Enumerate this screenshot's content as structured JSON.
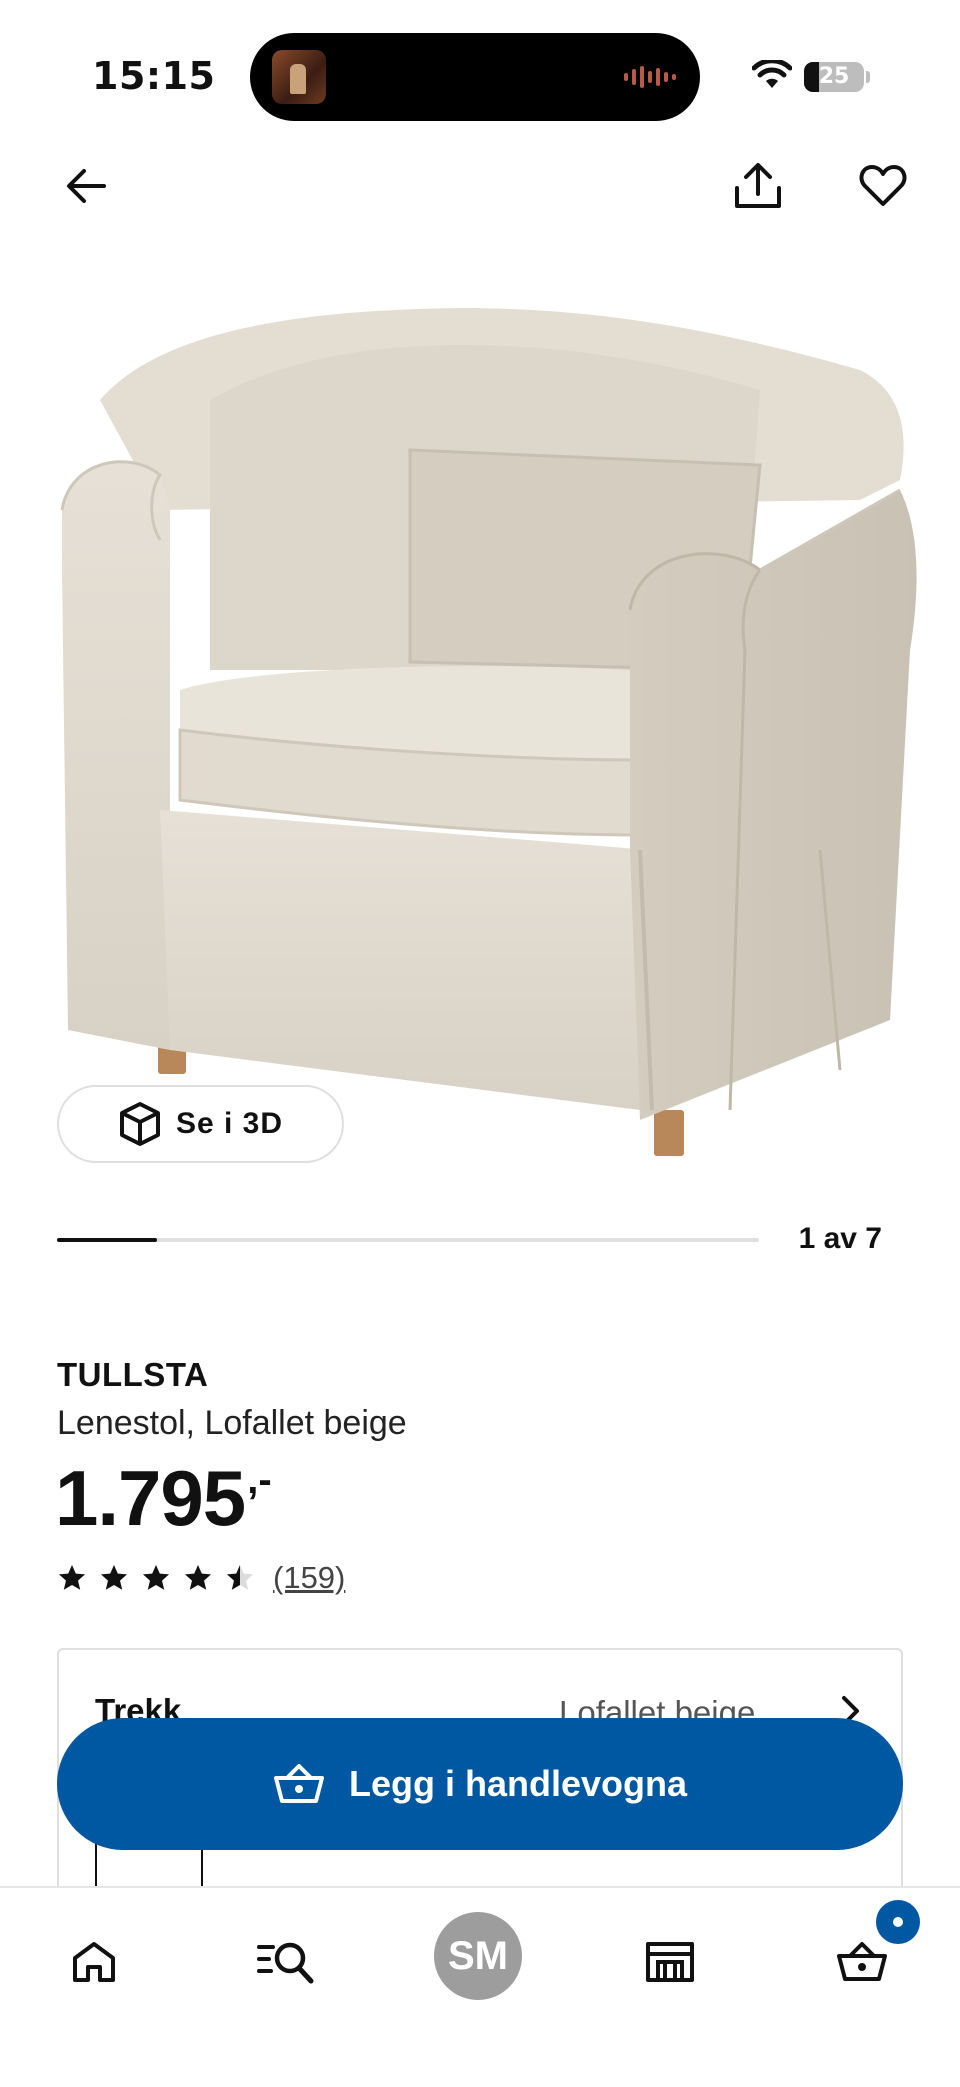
{
  "status_bar": {
    "time": "15:15",
    "battery_level": "25",
    "battery_fraction": 0.25
  },
  "header": {
    "back_icon": "arrow-left-icon",
    "share_icon": "share-icon",
    "favorite_icon": "heart-icon"
  },
  "gallery": {
    "view_3d_label": "Se i 3D",
    "view_3d_icon": "cube-icon",
    "counter": "1 av 7",
    "current_image": 1,
    "total_images": 7
  },
  "product": {
    "name": "TULLSTA",
    "description": "Lenestol, Lofallet beige",
    "price": "1.795",
    "price_suffix": ",-",
    "rating": 4.5,
    "rating_max": 5,
    "review_count": "(159)"
  },
  "variant": {
    "label": "Trekk",
    "value": "Lofallet beige",
    "chevron_icon": "chevron-right-icon"
  },
  "cta": {
    "add_to_cart_label": "Legg i handlevogna",
    "icon": "basket-icon"
  },
  "bottom_nav": {
    "home_icon": "home-icon",
    "search_icon": "search-list-icon",
    "profile_initials": "SM",
    "stores_icon": "store-icon",
    "cart_icon": "basket-icon",
    "cart_badge_visible": true
  },
  "colors": {
    "brand_blue": "#0058a3",
    "text": "#111111",
    "divider": "#dfdfdf",
    "avatar_gray": "#9d9d9d"
  }
}
